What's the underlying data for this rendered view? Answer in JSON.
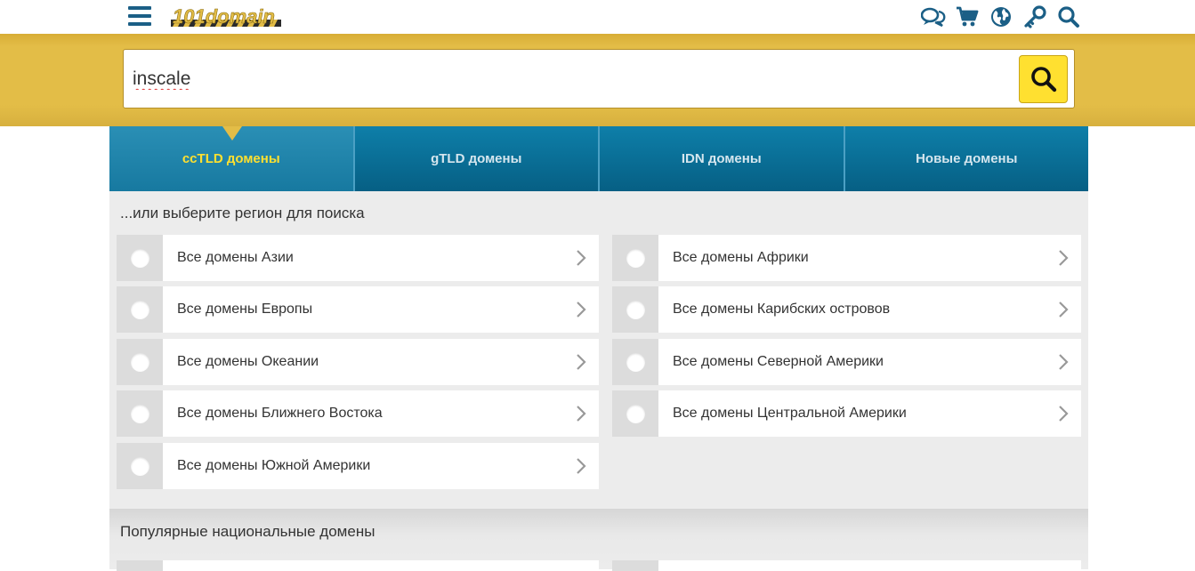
{
  "header": {
    "logo_text": "101domain",
    "icons": [
      "chat-icon",
      "cart-icon",
      "globe-icon",
      "key-icon",
      "search-icon"
    ]
  },
  "search": {
    "value": "inscale",
    "placeholder": ""
  },
  "tabs": [
    {
      "label": "ccTLD домены",
      "active": true
    },
    {
      "label": "gTLD домены",
      "active": false
    },
    {
      "label": "IDN домены",
      "active": false
    },
    {
      "label": "Новые домены",
      "active": false
    }
  ],
  "regions": {
    "title": "...или выберите регион для поиска",
    "items": [
      {
        "label": "Все домены Азии"
      },
      {
        "label": "Все домены Африки"
      },
      {
        "label": "Все домены Европы"
      },
      {
        "label": "Все домены Карибских островов"
      },
      {
        "label": "Все домены Океании"
      },
      {
        "label": "Все домены Северной Америки"
      },
      {
        "label": "Все домены Ближнего Востока"
      },
      {
        "label": "Все домены Центральной Америки"
      },
      {
        "label": "Все домены Южной Америки"
      }
    ]
  },
  "popular": {
    "title": "Популярные национальные домены"
  },
  "colors": {
    "brand_blue": "#1b5f86",
    "tab_blue": "#0a6f97",
    "accent_yellow": "#ffe030",
    "band_gold": "#e3bd47"
  }
}
